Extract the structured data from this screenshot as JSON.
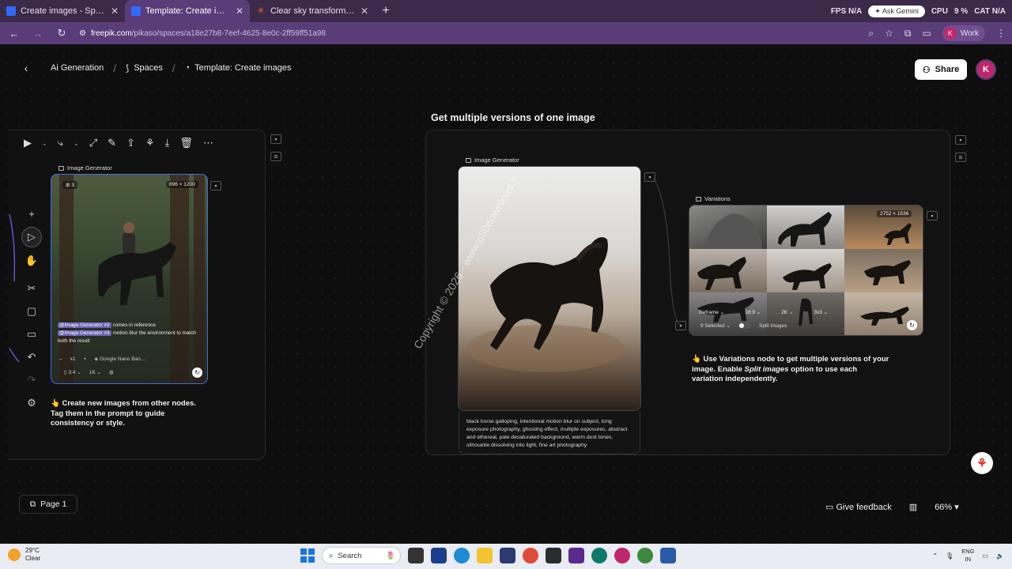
{
  "browser": {
    "tabs": [
      {
        "title": "Create images - Spaces | Freepik",
        "active": false
      },
      {
        "title": "Template: Create images - Spaces | Freepik",
        "active": true
      },
      {
        "title": "Clear sky transforming into wa...",
        "active": false
      }
    ],
    "new_tab": "+",
    "stats": [
      "FPS N/A",
      "CPU",
      "9 %",
      "CAT N/A"
    ],
    "ask_gemini": "Ask Gemini",
    "url_host": "freepik.com",
    "url_path": "/pikaso/spaces/a18e27b8-7eef-4625-8e0c-2ff59ff51a98",
    "profile_initial": "K",
    "profile_label": "Work"
  },
  "app": {
    "breadcrumb": {
      "root": "Ai Generation",
      "spaces": "Spaces",
      "template": "Template: Create images"
    },
    "share_label": "Share",
    "user_initial": "K",
    "group_title": "Get multiple versions of one image",
    "left_node": {
      "label": "Image Generator",
      "count": "3",
      "dimensions": "896 × 1200",
      "tag1": "@Image Generator #2",
      "text1": " comes in reference",
      "tag2": "@Image Generator #3",
      "text2": " motion blur the environment to match both the result",
      "multiplier": "x1",
      "plus": "+",
      "model": "Google Nano Ban...",
      "ratio": "3:4",
      "resolution": "1K"
    },
    "left_note": "👆 Create new images from other nodes. Tag them in the prompt to guide consistency or style.",
    "mid_node": {
      "label": "Image Generator",
      "prompt": "black horse galloping, intentional motion blur on subject, long exposure photography, ghosting effect, multiple exposures, abstract and ethereal, pale desaturated background, warm dust tones, silhouette dissolving into light, fine art photography"
    },
    "watermark": "Copyright © 2026 - www.p30download.ir",
    "variations_node": {
      "label": "Variations",
      "dimensions": "2752 × 1536",
      "reframe": "Reframe",
      "ratio": "16:9",
      "resolution": "2K",
      "grid": "3x3",
      "selected": "9 Selected",
      "split": "Split images"
    },
    "right_note_prefix": "👆 Use Variations node to get multiple versions of your image. Enable ",
    "right_note_em": "Split images",
    "right_note_suffix": " option to use each variation independently.",
    "page_label": "Page 1",
    "feedback_label": "Give feedback",
    "zoom": "66%"
  },
  "taskbar": {
    "temp": "29°C",
    "condition": "Clear",
    "search": "Search",
    "lang1": "ENG",
    "lang2": "IN"
  },
  "colors": {
    "tabbar": "#3c2a4a",
    "addrbar": "#5a3d78",
    "accent_blue": "#3f6de0",
    "tag_purple": "#6b63b5",
    "avatar": "#c0266b"
  }
}
